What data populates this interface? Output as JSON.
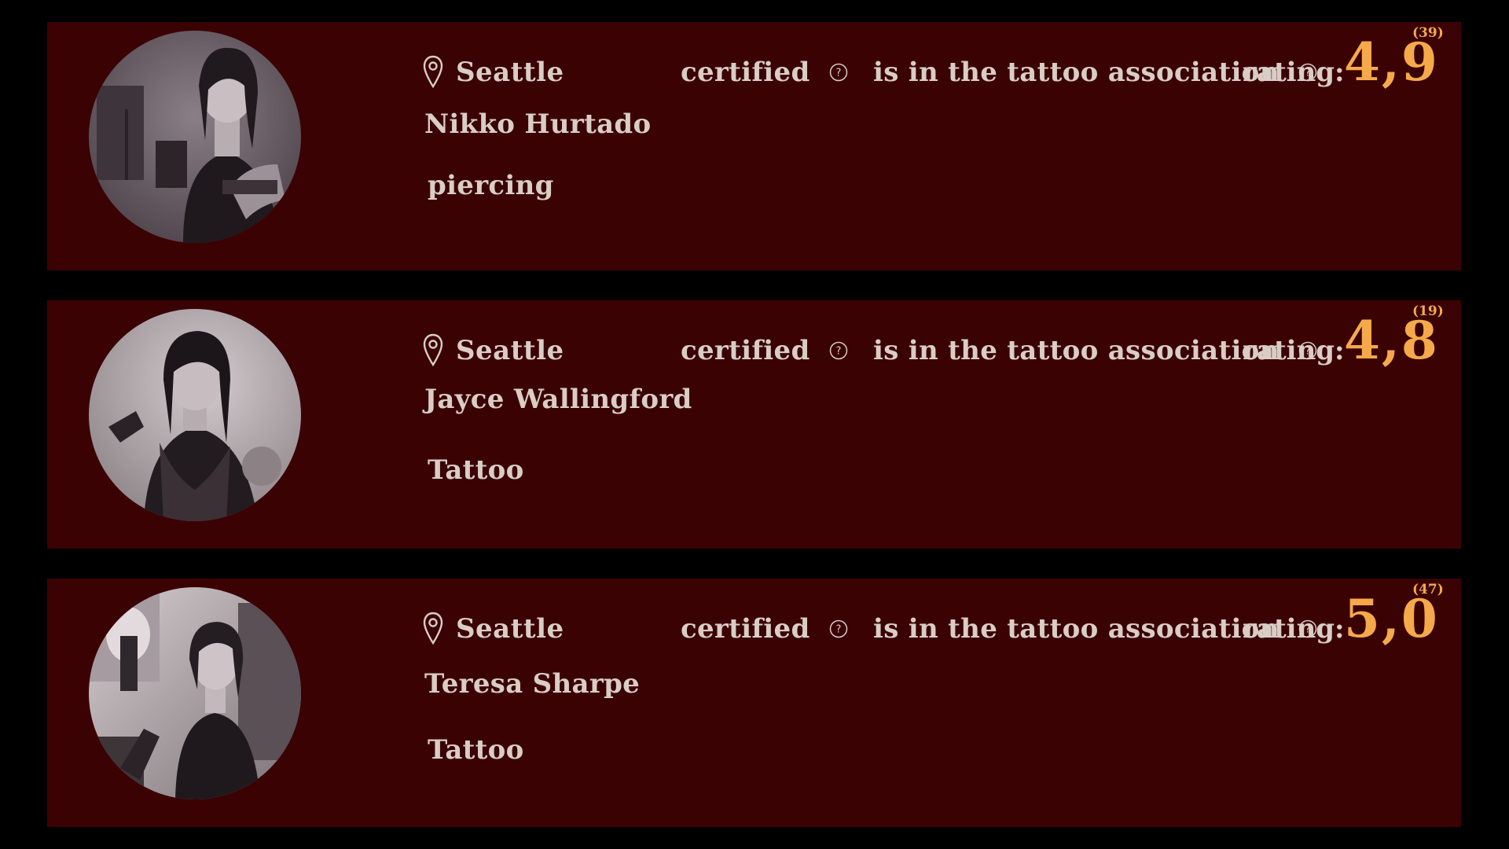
{
  "cards": [
    {
      "city": "Seattle",
      "certified_label": "certified",
      "association_label": "is in the tattoo association",
      "rating_label": "rating:",
      "rating_value": "4,9",
      "rating_count": "(39)",
      "name": "Nikko Hurtado",
      "specialty": "piercing"
    },
    {
      "city": "Seattle",
      "certified_label": "certified",
      "association_label": "is in the tattoo association",
      "rating_label": "rating:",
      "rating_value": "4,8",
      "rating_count": "(19)",
      "name": "Jayce Wallingford",
      "specialty": "Tattoo"
    },
    {
      "city": "Seattle",
      "certified_label": "certified",
      "association_label": "is in the tattoo association",
      "rating_label": "rating:",
      "rating_value": "5,0",
      "rating_count": "(47)",
      "name": "Teresa Sharpe",
      "specialty": "Tattoo"
    }
  ],
  "colors": {
    "page_background": "#000000",
    "card_background": "#3b0204",
    "text": "#d9cdc5",
    "accent": "#f5a94a"
  },
  "icons": {
    "location": "map-pin-icon",
    "help": "question-circle-icon"
  }
}
